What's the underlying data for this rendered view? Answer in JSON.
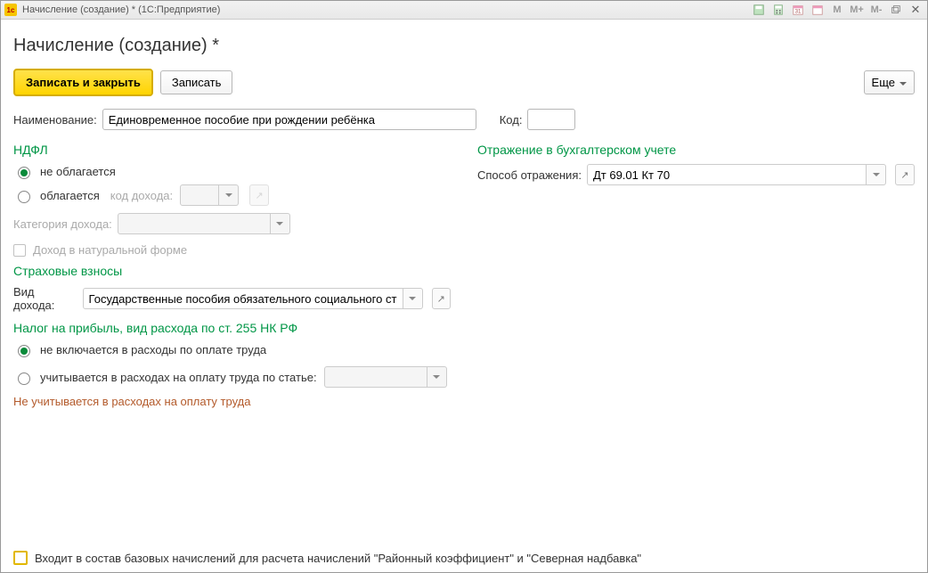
{
  "titlebar": {
    "app_icon_text": "1c",
    "title": "Начисление (создание) *  (1С:Предприятие)",
    "icons": [
      "save-icon",
      "calc-icon",
      "calendar-numbered-icon",
      "calendar-icon",
      "m-icon",
      "m-plus-icon",
      "m-minus-icon",
      "window-restore-icon",
      "close-icon"
    ],
    "m_text": "M",
    "m_plus_text": "M+",
    "m_minus_text": "M-"
  },
  "page": {
    "title": "Начисление (создание) *"
  },
  "toolbar": {
    "save_close": "Записать и закрыть",
    "save": "Записать",
    "more": "Еще"
  },
  "fields": {
    "name_label": "Наименование:",
    "name_value": "Единовременное пособие при рождении ребёнка",
    "code_label": "Код:",
    "code_value": ""
  },
  "ndfl": {
    "title": "НДФЛ",
    "not_taxed": "не облагается",
    "taxed": "облагается",
    "income_code_label": "код дохода:",
    "income_code_value": "",
    "category_label": "Категория дохода:",
    "category_value": "",
    "in_kind_label": "Доход в натуральной форме"
  },
  "accounting": {
    "title": "Отражение в бухгалтерском учете",
    "method_label": "Способ отражения:",
    "method_value": "Дт 69.01 Кт 70"
  },
  "insurance": {
    "title": "Страховые взносы",
    "kind_label": "Вид дохода:",
    "kind_value": "Государственные пособия обязательного социального страх"
  },
  "profit_tax": {
    "title": "Налог на прибыль, вид расхода по ст. 255 НК РФ",
    "not_included": "не включается в расходы по оплате труда",
    "included": "учитывается в расходах на оплату труда по статье:",
    "article_value": "",
    "note": "Не учитывается в расходах на оплату труда"
  },
  "footer": {
    "base_label": "Входит в состав базовых начислений для расчета начислений \"Районный коэффициент\" и \"Северная надбавка\""
  }
}
